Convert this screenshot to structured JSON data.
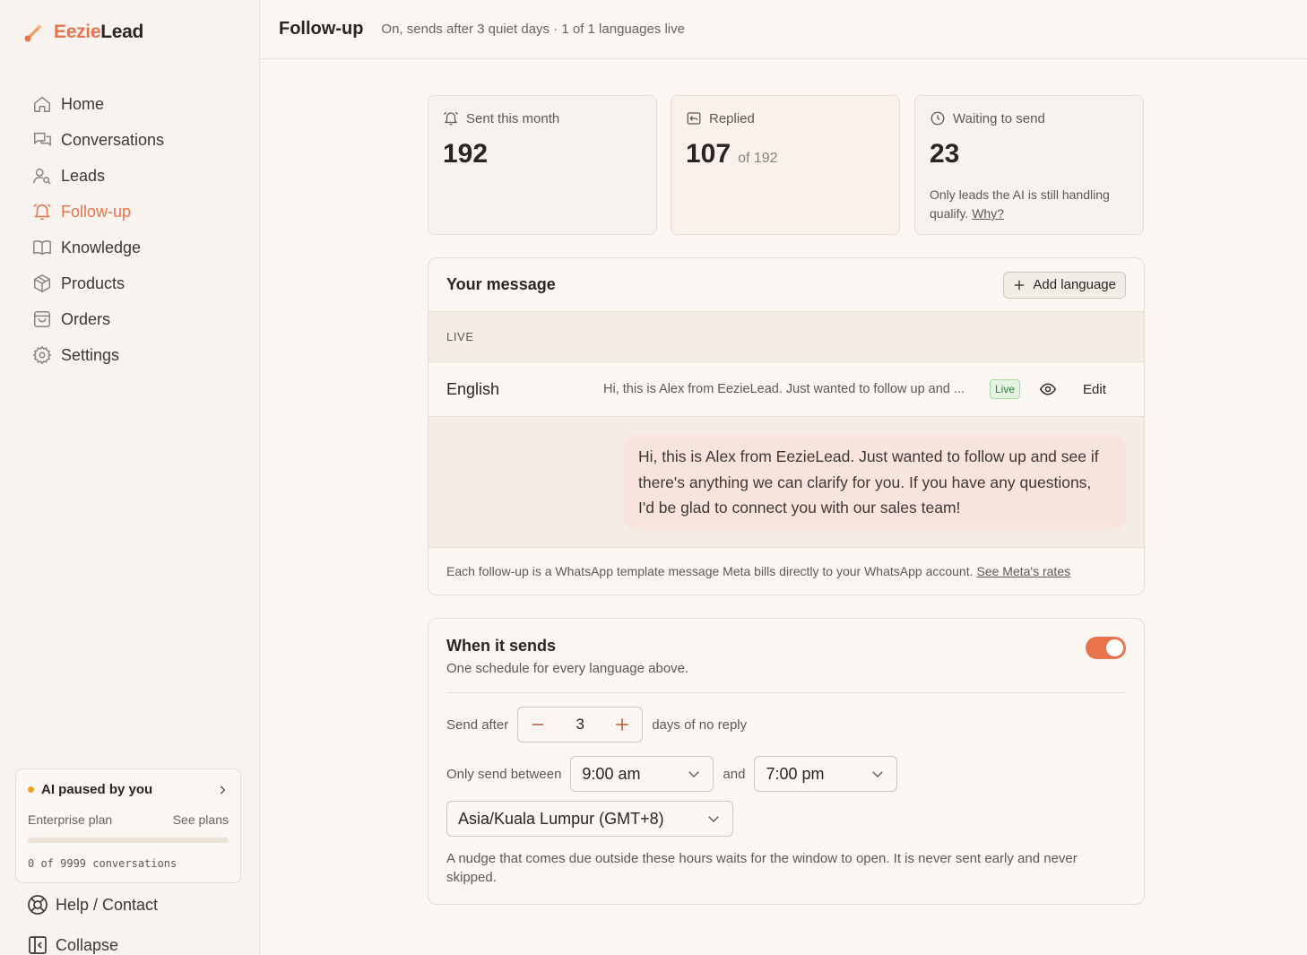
{
  "brand": {
    "part1": "Eezie",
    "part2": "Lead",
    "accent": "#e8734c"
  },
  "nav": [
    {
      "label": "Home",
      "icon": "home-icon",
      "active": false
    },
    {
      "label": "Conversations",
      "icon": "chat-icon",
      "active": false
    },
    {
      "label": "Leads",
      "icon": "user-search-icon",
      "active": false
    },
    {
      "label": "Follow-up",
      "icon": "bell-icon",
      "active": true
    },
    {
      "label": "Knowledge",
      "icon": "book-icon",
      "active": false
    },
    {
      "label": "Products",
      "icon": "box-icon",
      "active": false
    },
    {
      "label": "Orders",
      "icon": "bag-icon",
      "active": false
    },
    {
      "label": "Settings",
      "icon": "gear-icon",
      "active": false
    }
  ],
  "status": {
    "title": "AI paused by you",
    "plan": "Enterprise plan",
    "plans_link": "See plans",
    "usage": "0 of 9999 conversations",
    "usage_fraction": 0
  },
  "bottom": {
    "help": "Help / Contact",
    "collapse": "Collapse"
  },
  "header": {
    "title": "Follow-up",
    "subtitle": "On, sends after 3 quiet days · 1 of 1 languages live"
  },
  "stats": {
    "sent": {
      "label": "Sent this month",
      "value": "192"
    },
    "replied": {
      "label": "Replied",
      "value": "107",
      "of": "of 192"
    },
    "waiting": {
      "label": "Waiting to send",
      "value": "23",
      "note": "Only leads the AI is still handling qualify.",
      "link": "Why?"
    }
  },
  "message": {
    "title": "Your message",
    "add_language": "Add language",
    "section": "LIVE",
    "language": "English",
    "preview": "Hi, this is Alex from EezieLead. Just wanted to follow up and ...",
    "badge": "Live",
    "edit": "Edit",
    "full_text": "Hi, this is Alex from EezieLead. Just wanted to follow up and see if there's anything we can clarify for you. If you have any questions, I'd be glad to connect you with our sales team!",
    "footnote": "Each follow-up is a WhatsApp template message Meta bills directly to your WhatsApp account.",
    "footnote_link": "See Meta's rates"
  },
  "schedule": {
    "title": "When it sends",
    "subtitle": "One schedule for every language above.",
    "enabled": true,
    "send_after_label": "Send after",
    "days": "3",
    "days_suffix": "days of no reply",
    "between_label": "Only send between",
    "start": "9:00 am",
    "and": "and",
    "end": "7:00 pm",
    "timezone": "Asia/Kuala Lumpur (GMT+8)",
    "explain": "A nudge that comes due outside these hours waits for the window to open. It is never sent early and never skipped."
  }
}
